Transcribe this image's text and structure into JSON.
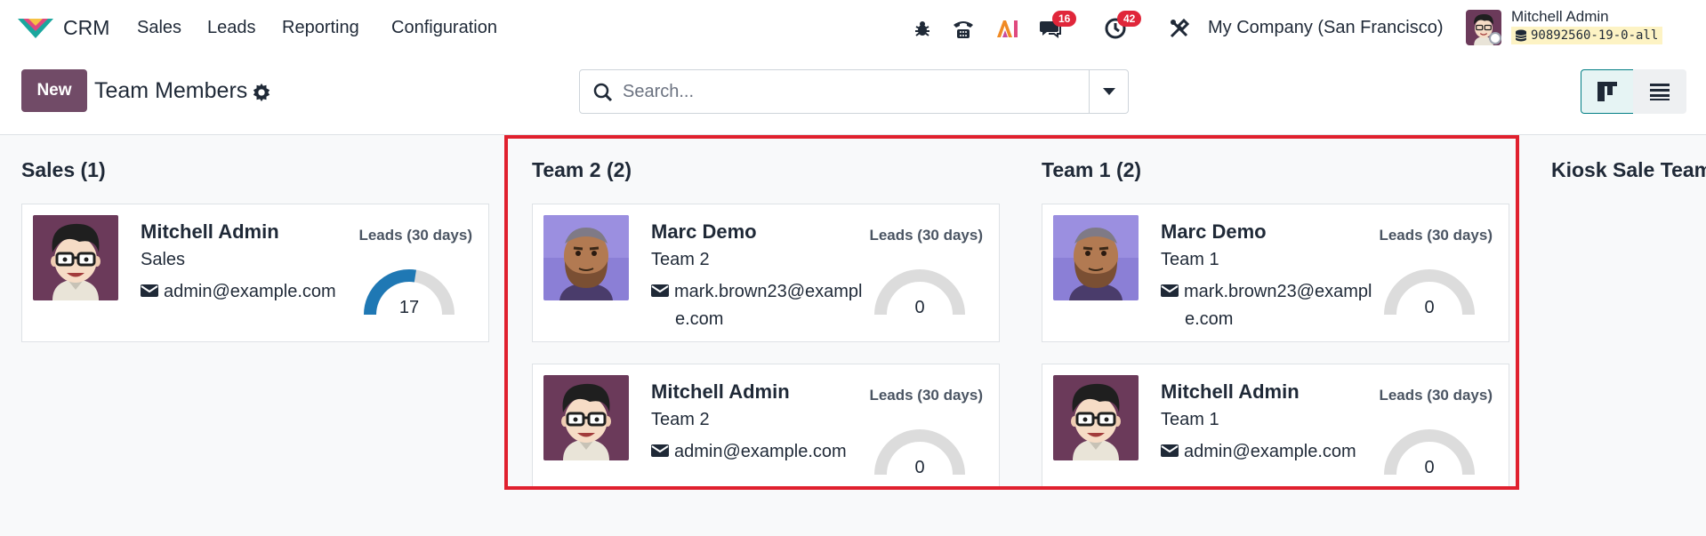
{
  "nav": {
    "app_name": "CRM",
    "menu": [
      "Sales",
      "Leads",
      "Reporting",
      "Configuration"
    ],
    "icons": [
      "bug-icon",
      "phone-icon",
      "ai-icon",
      "chat-icon",
      "activity-clock-icon",
      "settings-tools-icon"
    ],
    "chat_badge": "16",
    "activity_badge": "42",
    "company": "My Company (San Francisco)",
    "user_name": "Mitchell Admin",
    "database": "90892560-19-0-all"
  },
  "control": {
    "new_label": "New",
    "title": "Team Members",
    "search_placeholder": "Search..."
  },
  "columns": [
    {
      "title": "Sales (1)",
      "cards": [
        {
          "name": "Mitchell Admin",
          "team": "Sales",
          "email": "admin@example.com",
          "leads_label": "Leads (30 days)",
          "leads": "17",
          "gauge_fraction": 0.55
        }
      ]
    },
    {
      "title": "Team 2 (2)",
      "cards": [
        {
          "name": "Marc Demo",
          "team": "Team 2",
          "email": "mark.brown23@example.com",
          "leads_label": "Leads (30 days)",
          "leads": "0",
          "gauge_fraction": 0
        },
        {
          "name": "Mitchell Admin",
          "team": "Team 2",
          "email": "admin@example.com",
          "leads_label": "Leads (30 days)",
          "leads": "0",
          "gauge_fraction": 0
        }
      ]
    },
    {
      "title": "Team 1 (2)",
      "cards": [
        {
          "name": "Marc Demo",
          "team": "Team 1",
          "email": "mark.brown23@example.com",
          "leads_label": "Leads (30 days)",
          "leads": "0",
          "gauge_fraction": 0
        },
        {
          "name": "Mitchell Admin",
          "team": "Team 1",
          "email": "admin@example.com",
          "leads_label": "Leads (30 days)",
          "leads": "0",
          "gauge_fraction": 0
        }
      ]
    },
    {
      "title": "Kiosk Sale Team",
      "cards": []
    }
  ],
  "colors": {
    "brand": "#714b67",
    "gauge_fill": "#1f78b4",
    "gauge_track": "#dcdcdc",
    "highlight": "#e0202e"
  }
}
